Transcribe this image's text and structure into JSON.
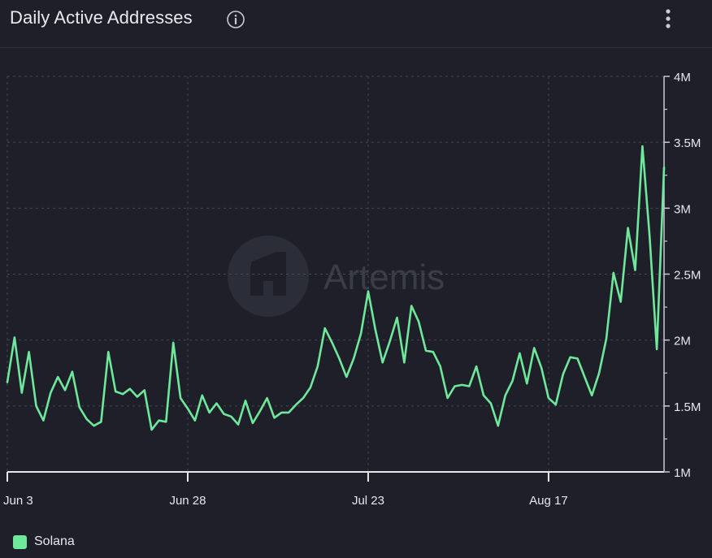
{
  "header": {
    "title": "Daily Active Addresses",
    "info_icon": "info-circle-icon",
    "menu_icon": "kebab-menu-icon"
  },
  "watermark": {
    "text": "Artemis",
    "icon": "artemis-logo-icon"
  },
  "chart_data": {
    "type": "line",
    "title": "Daily Active Addresses",
    "xlabel": "",
    "ylabel": "",
    "ylim": [
      1000000,
      4000000
    ],
    "y_ticks": [
      1000000,
      1500000,
      2000000,
      2500000,
      3000000,
      3500000,
      4000000
    ],
    "y_tick_labels": [
      "1M",
      "1.5M",
      "2M",
      "2.5M",
      "3M",
      "3.5M",
      "4M"
    ],
    "x_tick_labels": [
      "Jun 3",
      "Jun 28",
      "Jul 23",
      "Aug 17"
    ],
    "x_tick_index": [
      0,
      25,
      50,
      75
    ],
    "grid": true,
    "legend_position": "bottom-left",
    "series": [
      {
        "name": "Solana",
        "color": "#6ee89a",
        "values": [
          1680000,
          2020000,
          1600000,
          1910000,
          1500000,
          1390000,
          1600000,
          1720000,
          1620000,
          1760000,
          1490000,
          1400000,
          1350000,
          1380000,
          1910000,
          1610000,
          1590000,
          1630000,
          1570000,
          1620000,
          1320000,
          1390000,
          1380000,
          1980000,
          1560000,
          1480000,
          1390000,
          1580000,
          1450000,
          1520000,
          1440000,
          1420000,
          1360000,
          1540000,
          1370000,
          1460000,
          1560000,
          1410000,
          1450000,
          1450000,
          1510000,
          1560000,
          1640000,
          1800000,
          2090000,
          1980000,
          1860000,
          1720000,
          1860000,
          2050000,
          2370000,
          2080000,
          1830000,
          1990000,
          2170000,
          1830000,
          2260000,
          2140000,
          1920000,
          1910000,
          1800000,
          1560000,
          1650000,
          1660000,
          1650000,
          1800000,
          1580000,
          1520000,
          1350000,
          1580000,
          1690000,
          1900000,
          1670000,
          1940000,
          1790000,
          1560000,
          1510000,
          1740000,
          1870000,
          1860000,
          1720000,
          1580000,
          1750000,
          2010000,
          2510000,
          2290000,
          2850000,
          2530000,
          3470000,
          2790000,
          1930000,
          3310000
        ]
      }
    ]
  }
}
